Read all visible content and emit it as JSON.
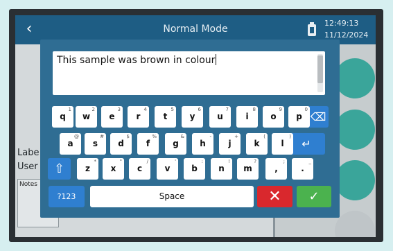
{
  "header": {
    "title": "Normal Mode",
    "back_icon": "‹",
    "time": "12:49:13",
    "date": "11/12/2024"
  },
  "background": {
    "label_text": "Labe",
    "user_text": "User",
    "notes_label": "Notes",
    "accent_color": "#3aa59a"
  },
  "editor": {
    "value": "This sample was brown in colour"
  },
  "keyboard": {
    "row1": [
      {
        "key": "q",
        "sub": "1"
      },
      {
        "key": "w",
        "sub": "2"
      },
      {
        "key": "e",
        "sub": "3"
      },
      {
        "key": "r",
        "sub": "4"
      },
      {
        "key": "t",
        "sub": "5"
      },
      {
        "key": "y",
        "sub": "6"
      },
      {
        "key": "u",
        "sub": "7"
      },
      {
        "key": "i",
        "sub": "8"
      },
      {
        "key": "o",
        "sub": "9"
      },
      {
        "key": "p",
        "sub": "0"
      }
    ],
    "row2": [
      {
        "key": "a",
        "sub": "@"
      },
      {
        "key": "s",
        "sub": "#"
      },
      {
        "key": "d",
        "sub": "$"
      },
      {
        "key": "f",
        "sub": "%"
      },
      {
        "key": "g",
        "sub": "&"
      },
      {
        "key": "h",
        "sub": "-"
      },
      {
        "key": "j",
        "sub": "+"
      },
      {
        "key": "k",
        "sub": "("
      },
      {
        "key": "l",
        "sub": ")"
      }
    ],
    "row3": [
      {
        "key": "z",
        "sub": "*"
      },
      {
        "key": "x",
        "sub": "\""
      },
      {
        "key": "c",
        "sub": "/"
      },
      {
        "key": "v",
        "sub": "'"
      },
      {
        "key": "b",
        "sub": ":"
      },
      {
        "key": "n",
        "sub": "!"
      },
      {
        "key": "m",
        "sub": "?"
      },
      {
        "key": ",",
        "sub": ";"
      },
      {
        "key": ".",
        "sub": "_"
      }
    ],
    "backspace_icon": "⌫",
    "enter_icon": "↵",
    "shift_icon": "⇧",
    "symbols_label": "?123",
    "space_label": "Space",
    "cancel_icon": "✕",
    "confirm_icon": "✓"
  }
}
